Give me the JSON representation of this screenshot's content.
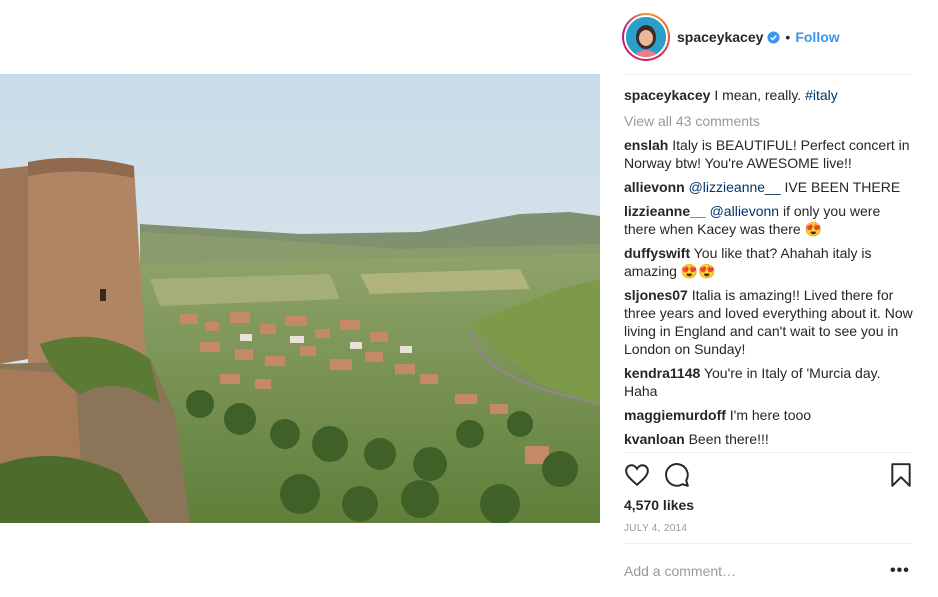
{
  "post": {
    "image_alt": "View of an Italian hill town and valley beside a round stone tower",
    "author": {
      "username": "spaceykacey",
      "verified": true,
      "follow_label": "Follow",
      "separator": "•"
    },
    "caption": {
      "username": "spaceykacey",
      "text": "I mean, really.",
      "hashtag": "#italy"
    },
    "view_all_label": "View all 43 comments",
    "comments": [
      {
        "username": "enslah",
        "mention": "",
        "text": "Italy is BEAUTIFUL! Perfect concert in Norway btw! You're AWESOME live!!"
      },
      {
        "username": "allievonn",
        "mention": "@lizzieanne__",
        "text": "IVE BEEN THERE"
      },
      {
        "username": "lizzieanne__",
        "mention": "@allievonn",
        "text": "if only you were there when Kacey was there 😍"
      },
      {
        "username": "duffyswift",
        "mention": "",
        "text": "You like that? Ahahah italy is amazing 😍😍"
      },
      {
        "username": "sljones07",
        "mention": "",
        "text": "Italia is amazing!! Lived there for three years and loved everything about it. Now living in England and can't wait to see you in London on Sunday!"
      },
      {
        "username": "kendra1148",
        "mention": "",
        "text": "You're in Italy of 'Murcia day. Haha"
      },
      {
        "username": "maggiemurdoff",
        "mention": "",
        "text": "I'm here tooo"
      },
      {
        "username": "kvanloan",
        "mention": "",
        "text": "Been there!!!"
      }
    ],
    "actions": {
      "like_icon": "heart-icon",
      "comment_icon": "comment-icon",
      "save_icon": "bookmark-icon"
    },
    "likes_label": "4,570 likes",
    "date_label": "JULY 4, 2014",
    "add_comment_placeholder": "Add a comment…",
    "more_label": "•••"
  },
  "colors": {
    "link": "#3897f0",
    "mention": "#003569",
    "muted": "#999999",
    "text": "#262626"
  }
}
